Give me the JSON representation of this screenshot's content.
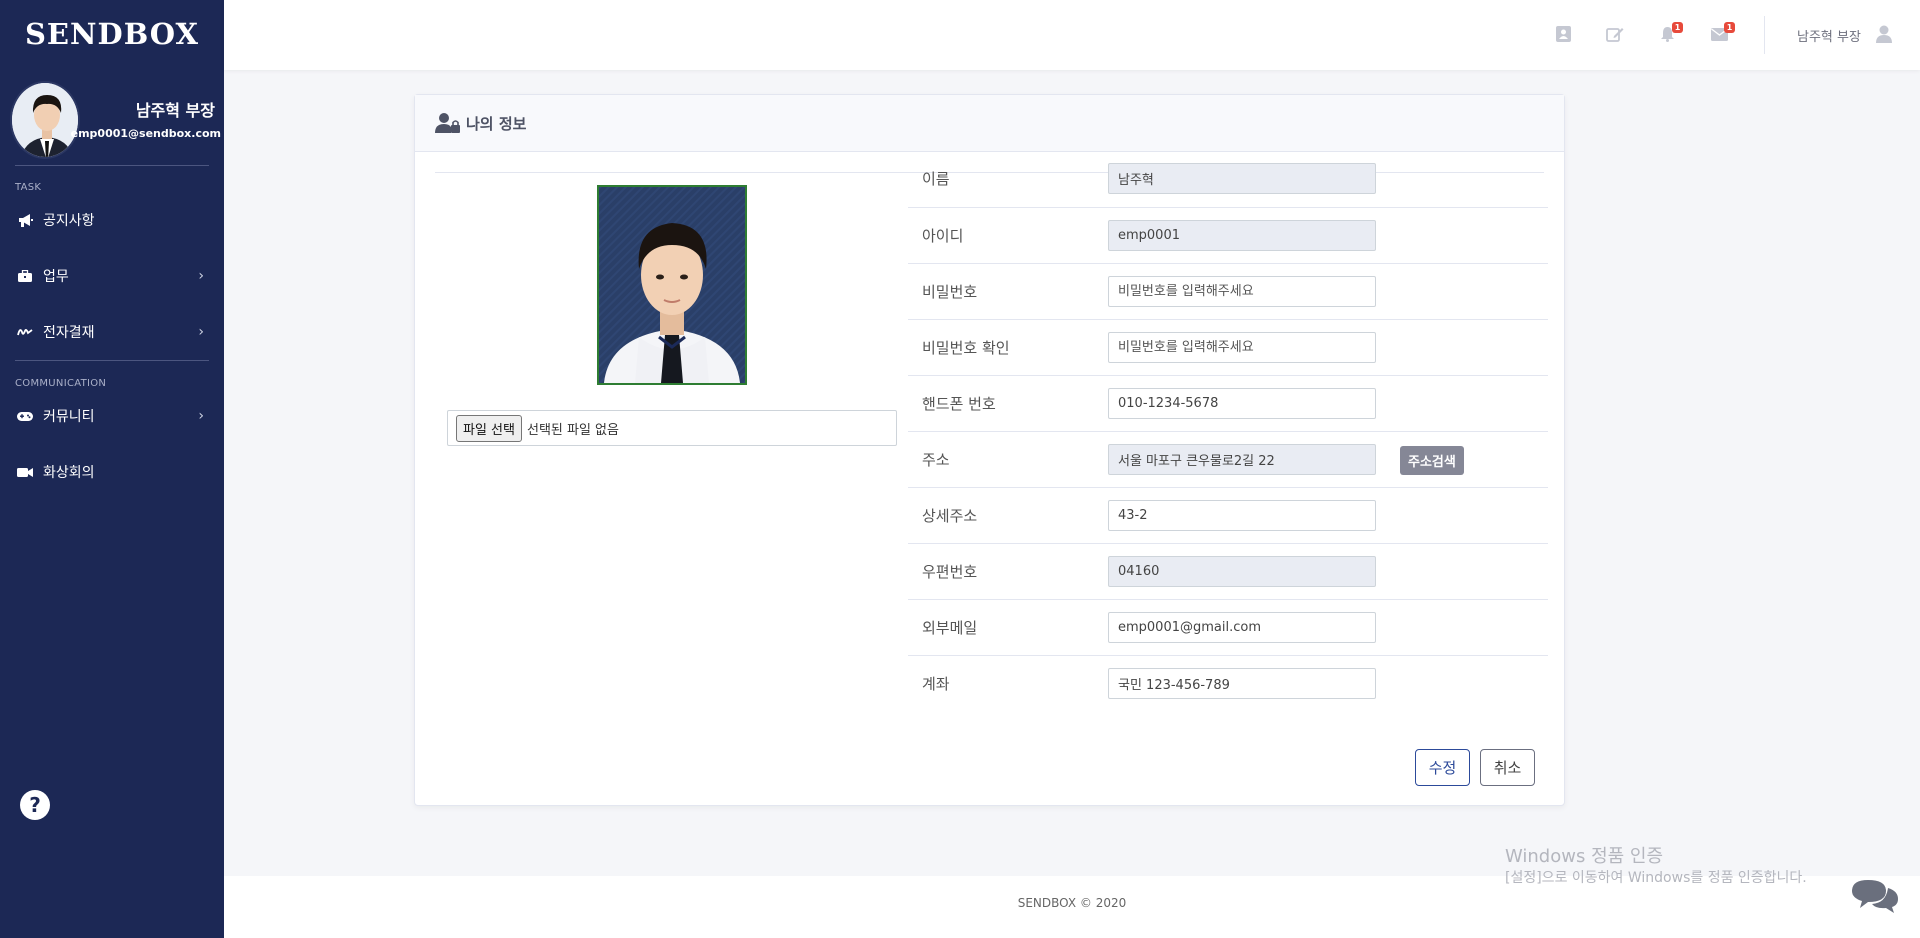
{
  "brand": "SENDBOX",
  "profile": {
    "name": "남주혁 부장",
    "email": "emp0001@sendbox.com"
  },
  "sidebar": {
    "sections": [
      {
        "title": "TASK",
        "items": [
          {
            "label": "공지사항",
            "icon": "megaphone-icon",
            "has_submenu": false
          },
          {
            "label": "업무",
            "icon": "briefcase-icon",
            "has_submenu": true
          },
          {
            "label": "전자결재",
            "icon": "signature-icon",
            "has_submenu": true
          }
        ]
      },
      {
        "title": "COMMUNICATION",
        "items": [
          {
            "label": "커뮤니티",
            "icon": "gamepad-icon",
            "has_submenu": true
          },
          {
            "label": "화상회의",
            "icon": "video-icon",
            "has_submenu": false
          }
        ]
      }
    ]
  },
  "topbar": {
    "icons": [
      "contact-card-icon",
      "edit-icon",
      "bell-icon",
      "envelope-icon"
    ],
    "alerts_count": "1",
    "messages_count": "1",
    "user_label": "남주혁 부장"
  },
  "card": {
    "title": "나의 정보",
    "file_button": "파일 선택",
    "file_status": "선택된 파일 없음",
    "fields": [
      {
        "label": "이름",
        "value": "남주혁",
        "readonly": true
      },
      {
        "label": "아이디",
        "value": "emp0001",
        "readonly": true
      },
      {
        "label": "비밀번호",
        "placeholder": "비밀번호를 입력해주세요",
        "readonly": false
      },
      {
        "label": "비밀번호 확인",
        "placeholder": "비밀번호를 입력해주세요",
        "readonly": false
      },
      {
        "label": "핸드폰 번호",
        "value": "010-1234-5678",
        "readonly": false
      },
      {
        "label": "주소",
        "value": "서울 마포구 큰우물로2길 22",
        "readonly": true
      },
      {
        "label": "상세주소",
        "value": "43-2",
        "readonly": false
      },
      {
        "label": "우편번호",
        "value": "04160",
        "readonly": true
      },
      {
        "label": "외부메일",
        "value": "emp0001@gmail.com",
        "readonly": false
      },
      {
        "label": "계좌",
        "value": "국민 123-456-789",
        "readonly": false
      }
    ],
    "address_search_button": "주소검색",
    "edit_button": "수정",
    "cancel_button": "취소"
  },
  "watermark": {
    "title": "Windows 정품 인증",
    "subtitle": "[설정]으로 이동하여 Windows를 정품 인증합니다."
  },
  "footer": "SENDBOX © 2020",
  "colors": {
    "sidebar_bg": "#1c2855",
    "badge": "#e74a3b",
    "primary": "#2c4a9a"
  }
}
